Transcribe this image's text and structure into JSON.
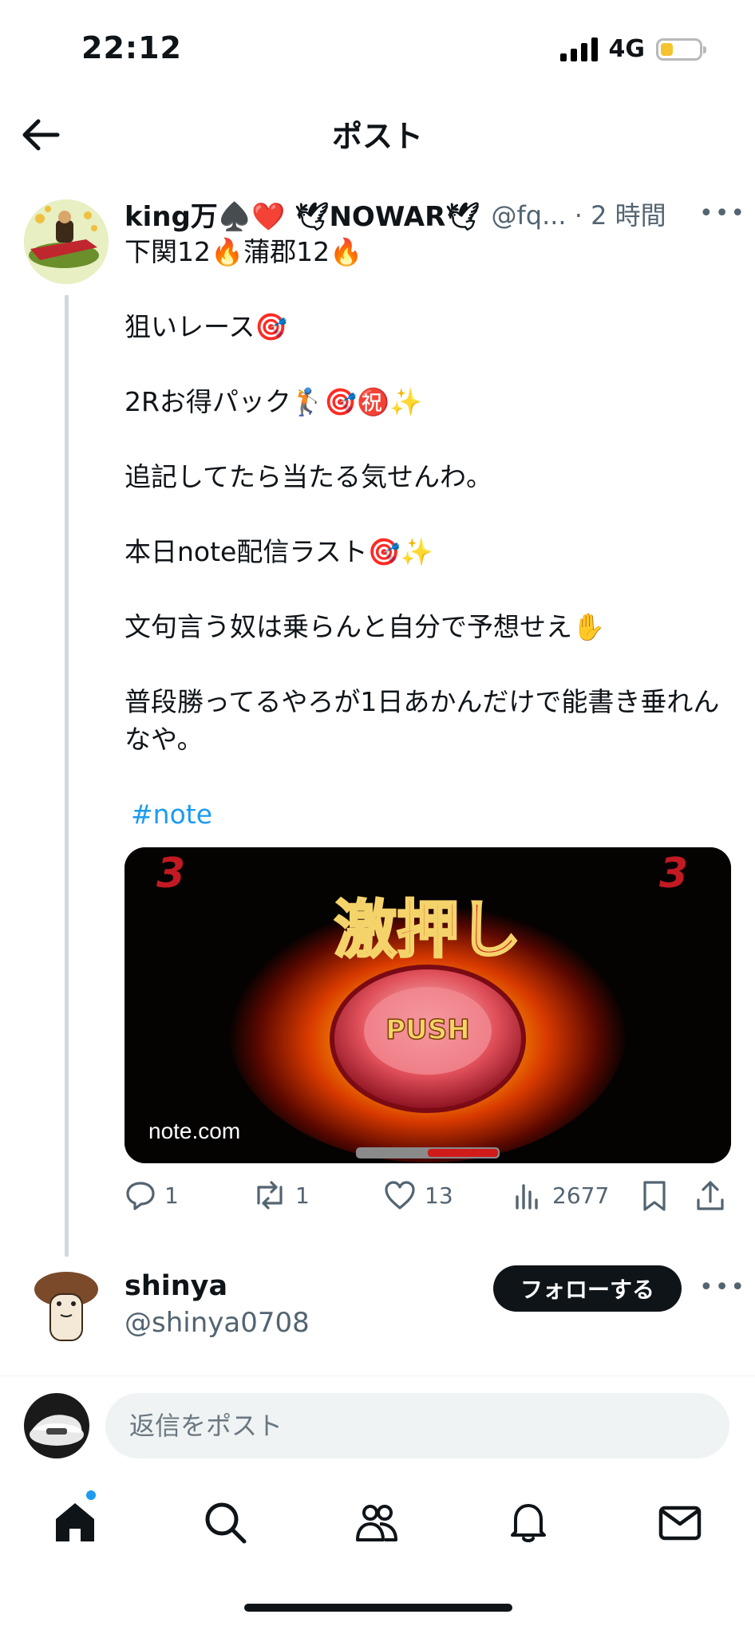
{
  "status_bar": {
    "time": "22:12",
    "network": "4G",
    "battery_level": 0.3
  },
  "header": {
    "title": "ポスト"
  },
  "post": {
    "author_name": "king万♠️❤️ 🕊NOWAR🕊",
    "handle_time": "@fq... · 2 時間",
    "lines": [
      "下関12🔥蒲郡12🔥",
      "狙いレース🎯",
      "2Rお得パック🏌️🎯㊗️✨",
      "追記してたら当たる気せんわ。",
      "本日note配信ラスト🎯✨",
      "文句言う奴は乗らんと自分で予想せえ✋",
      "普段勝ってるやろが1日あかんだけで能書き垂れんなや。"
    ],
    "hashtag": "#note",
    "card": {
      "domain": "note.com",
      "image_text": "激押し",
      "button_text": "PUSH",
      "corner_digit": "3"
    },
    "stats": {
      "replies": "1",
      "reposts": "1",
      "likes": "13",
      "views": "2677"
    }
  },
  "follow_suggestion": {
    "name": "shinya",
    "handle": "@shinya0708",
    "follow_label": "フォローする"
  },
  "reply": {
    "placeholder": "返信をポスト"
  },
  "nav": {
    "items": [
      "home",
      "search",
      "communities",
      "notifications",
      "messages"
    ],
    "home_badge": true
  },
  "colors": {
    "accent": "#1d9bf0",
    "text": "#0f1419",
    "secondary": "#536471",
    "follow_button": "#0f1419"
  }
}
